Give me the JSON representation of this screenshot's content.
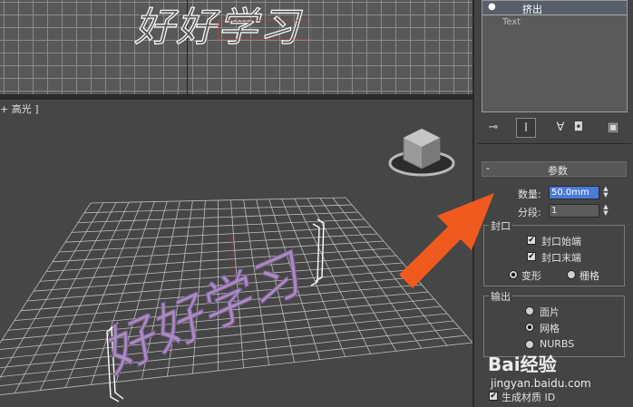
{
  "viewport_top": {
    "text_object": "好好学习"
  },
  "viewport_persp": {
    "label": "+ 高光 ]",
    "text_object": "好好学习"
  },
  "panel": {
    "stack_items": [
      {
        "label": "挤出",
        "selected": true
      },
      {
        "label": "Text",
        "selected": false
      }
    ],
    "toolbar_icons": [
      "pin-stack-icon",
      "show-end-result-icon",
      "make-unique-icon",
      "remove-modifier-icon",
      "configure-sets-icon"
    ],
    "rollout_title": "参数",
    "amount_label": "数量:",
    "amount_value": "50.0mm",
    "segments_label": "分段:",
    "segments_value": "1",
    "capping": {
      "title": "封口",
      "cap_start": "封口始端",
      "cap_end": "封口末端",
      "morph": "变形",
      "grid": "栅格"
    },
    "output": {
      "title": "输出",
      "patch": "面片",
      "mesh": "网格",
      "nurbs": "NURBS"
    },
    "gen_material_ids": "生成材质 ID"
  },
  "watermark": {
    "brand": "Bai经验",
    "url": "jingyan.baidu.com"
  },
  "colors": {
    "accent_arrow": "#f05a1e",
    "text_purple": "#a98cc0",
    "highlight_field": "#4c7ad8"
  }
}
